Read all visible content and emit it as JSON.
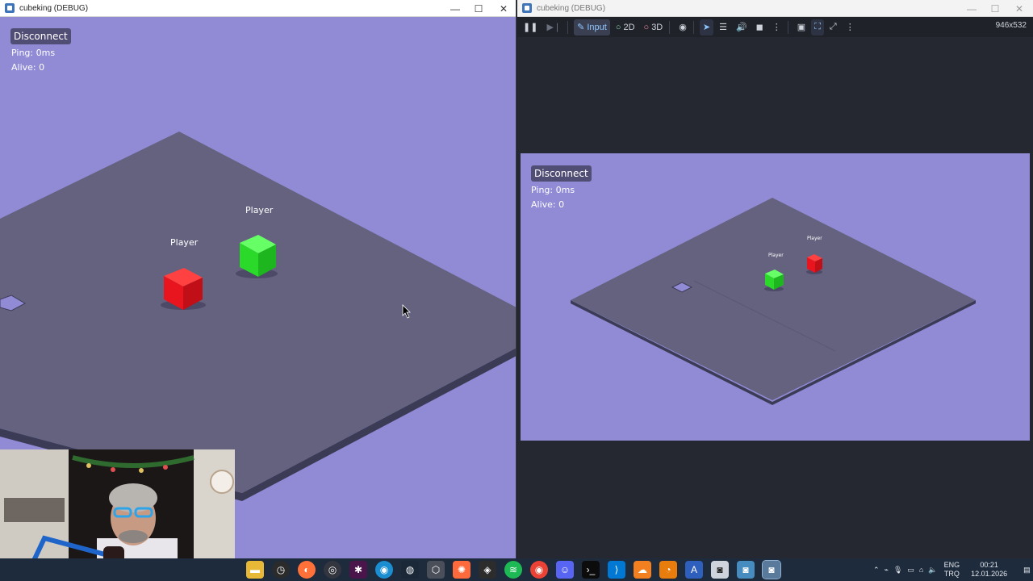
{
  "left_window": {
    "title": "cubeking (DEBUG)",
    "controls": {
      "minimize": "—",
      "maximize": "☐",
      "close": "✕"
    }
  },
  "hud": {
    "disconnect_label": "Disconnect",
    "ping": "Ping: 0ms",
    "alive": "Alive: 0"
  },
  "scene": {
    "player_label": "Player",
    "player_red_color": "#e8141e",
    "player_green_color": "#2ee62e",
    "floor_color": "#64627f",
    "sky_color": "#918bd6"
  },
  "right_window": {
    "title": "cubeking (DEBUG)",
    "controls": {
      "minimize": "—",
      "maximize": "☐",
      "close": "✕"
    },
    "toolbar": {
      "pause_icon": "pause-icon",
      "next_icon": "step-icon",
      "input_label": "Input",
      "label_2d": "2D",
      "label_3d": "3D",
      "resolution": "946x532"
    },
    "hud": {
      "disconnect_label": "Disconnect",
      "ping": "Ping: 0ms",
      "alive": "Alive: 0",
      "player_label_a": "Player",
      "player_label_b": "Player"
    }
  },
  "taskbar": {
    "language": "ENG",
    "region": "TRQ",
    "time": "00:21",
    "date": "12.01.2026"
  }
}
